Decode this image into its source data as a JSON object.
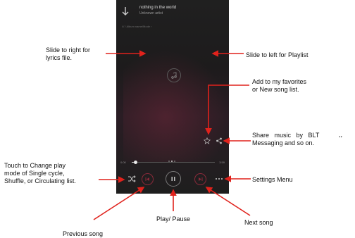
{
  "player": {
    "song_title": "nothing in the world",
    "artist": "Unknown artist",
    "lyrics_path": "/// / Album name/Mode ›",
    "time_elapsed": "0:00",
    "time_total": "3:59",
    "progress_fraction": 0.04
  },
  "annotations": {
    "slide_right": "Slide to right for\nlyrics file.",
    "slide_left": "Slide to left for Playlist",
    "favorites": "Add to my favorites\nor New song list.",
    "share": "Share   music   by   BLT\nMessaging and so on.",
    "share_extra": ",,",
    "change_mode": "Touch to Change play\nmode of Single cycle,\nShuffle, or Circulating list.",
    "settings": "Settings Menu",
    "play_pause": "Play/ Pause",
    "next_song": "Next song",
    "previous_song": "Previous song"
  },
  "colors": {
    "arrow": "#e0221c",
    "phone_bg": "#1e1e1e",
    "accent": "#8a2a3a"
  },
  "icons": [
    "back-arrow-icon",
    "music-note-icon",
    "star-icon",
    "share-icon",
    "shuffle-icon",
    "previous-icon",
    "pause-icon",
    "next-icon",
    "menu-dots-icon"
  ]
}
